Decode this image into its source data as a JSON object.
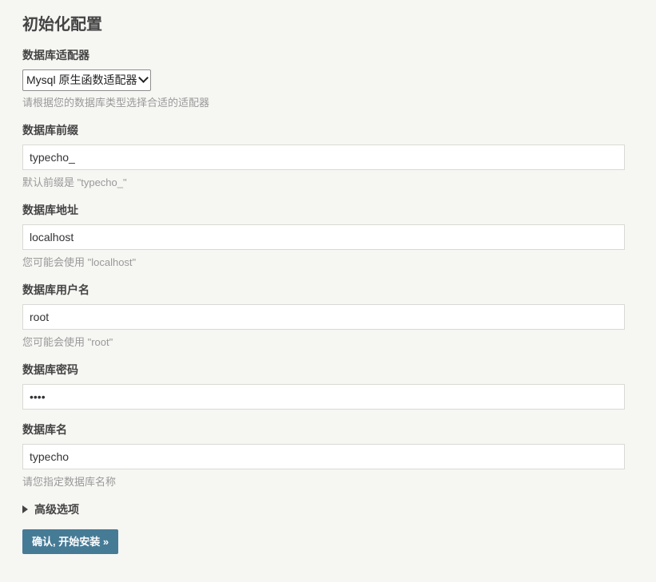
{
  "page": {
    "title": "初始化配置"
  },
  "adapter": {
    "label": "数据库适配器",
    "selected": "Mysql 原生函数适配器",
    "hint": "请根据您的数据库类型选择合适的适配器"
  },
  "prefix": {
    "label": "数据库前缀",
    "value": "typecho_",
    "hint": "默认前缀是 \"typecho_\""
  },
  "host": {
    "label": "数据库地址",
    "value": "localhost",
    "hint": "您可能会使用 \"localhost\""
  },
  "user": {
    "label": "数据库用户名",
    "value": "root",
    "hint": "您可能会使用 \"root\""
  },
  "password": {
    "label": "数据库密码",
    "value": "root"
  },
  "dbname": {
    "label": "数据库名",
    "value": "typecho",
    "hint": "请您指定数据库名称"
  },
  "advanced": {
    "label": "高级选项"
  },
  "submit": {
    "label": "确认, 开始安装 »"
  },
  "colors": {
    "background": "#f6f6f3",
    "button": "#467b96",
    "hint_text": "#999999",
    "label_text": "#444444"
  }
}
